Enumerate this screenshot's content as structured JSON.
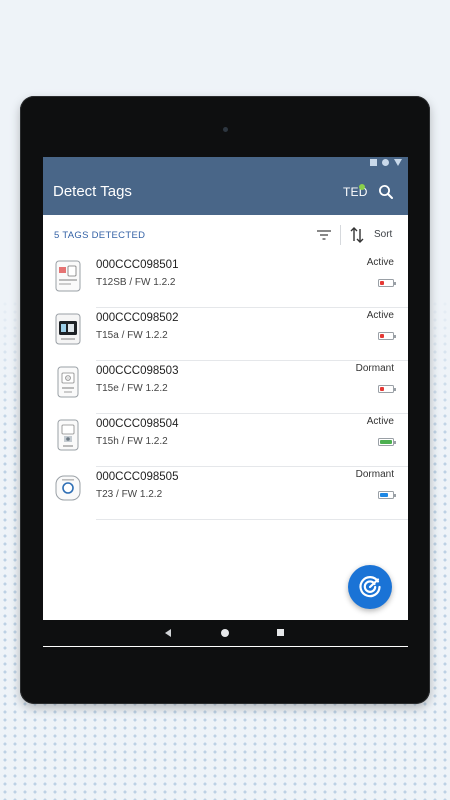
{
  "app": {
    "title": "Detect Tags",
    "user_badge": "TED",
    "user_status_color": "#8ad04a",
    "header_color": "#496688",
    "accent_color": "#1a73d6"
  },
  "statusbar": {
    "icons": [
      "square-icon",
      "circle-icon",
      "triangle-icon"
    ]
  },
  "toolbar": {
    "count_label": "5 TAGS DETECTED",
    "filter_icon": "filter-icon",
    "sort_label": "Sort",
    "sort_icon": "sort-arrows-icon"
  },
  "tags": [
    {
      "id": "000CCC098501",
      "model": "T12SB / FW 1.2.2",
      "state": "Active",
      "battery_level": 0.3,
      "battery_color": "#e53935",
      "thumb": "t12sb"
    },
    {
      "id": "000CCC098502",
      "model": "T15a / FW 1.2.2",
      "state": "Active",
      "battery_level": 0.3,
      "battery_color": "#e53935",
      "thumb": "t15a"
    },
    {
      "id": "000CCC098503",
      "model": "T15e / FW 1.2.2",
      "state": "Dormant",
      "battery_level": 0.3,
      "battery_color": "#e53935",
      "thumb": "t15e"
    },
    {
      "id": "000CCC098504",
      "model": "T15h / FW 1.2.2",
      "state": "Active",
      "battery_level": 1.0,
      "battery_color": "#4caf50",
      "thumb": "t15h"
    },
    {
      "id": "000CCC098505",
      "model": "T23 / FW 1.2.2",
      "state": "Dormant",
      "battery_level": 0.7,
      "battery_color": "#1e88e5",
      "thumb": "t23"
    }
  ],
  "fab": {
    "icon": "scan-radar-icon"
  },
  "navbar": {
    "icons": [
      "back-icon",
      "home-icon",
      "recents-icon"
    ]
  }
}
